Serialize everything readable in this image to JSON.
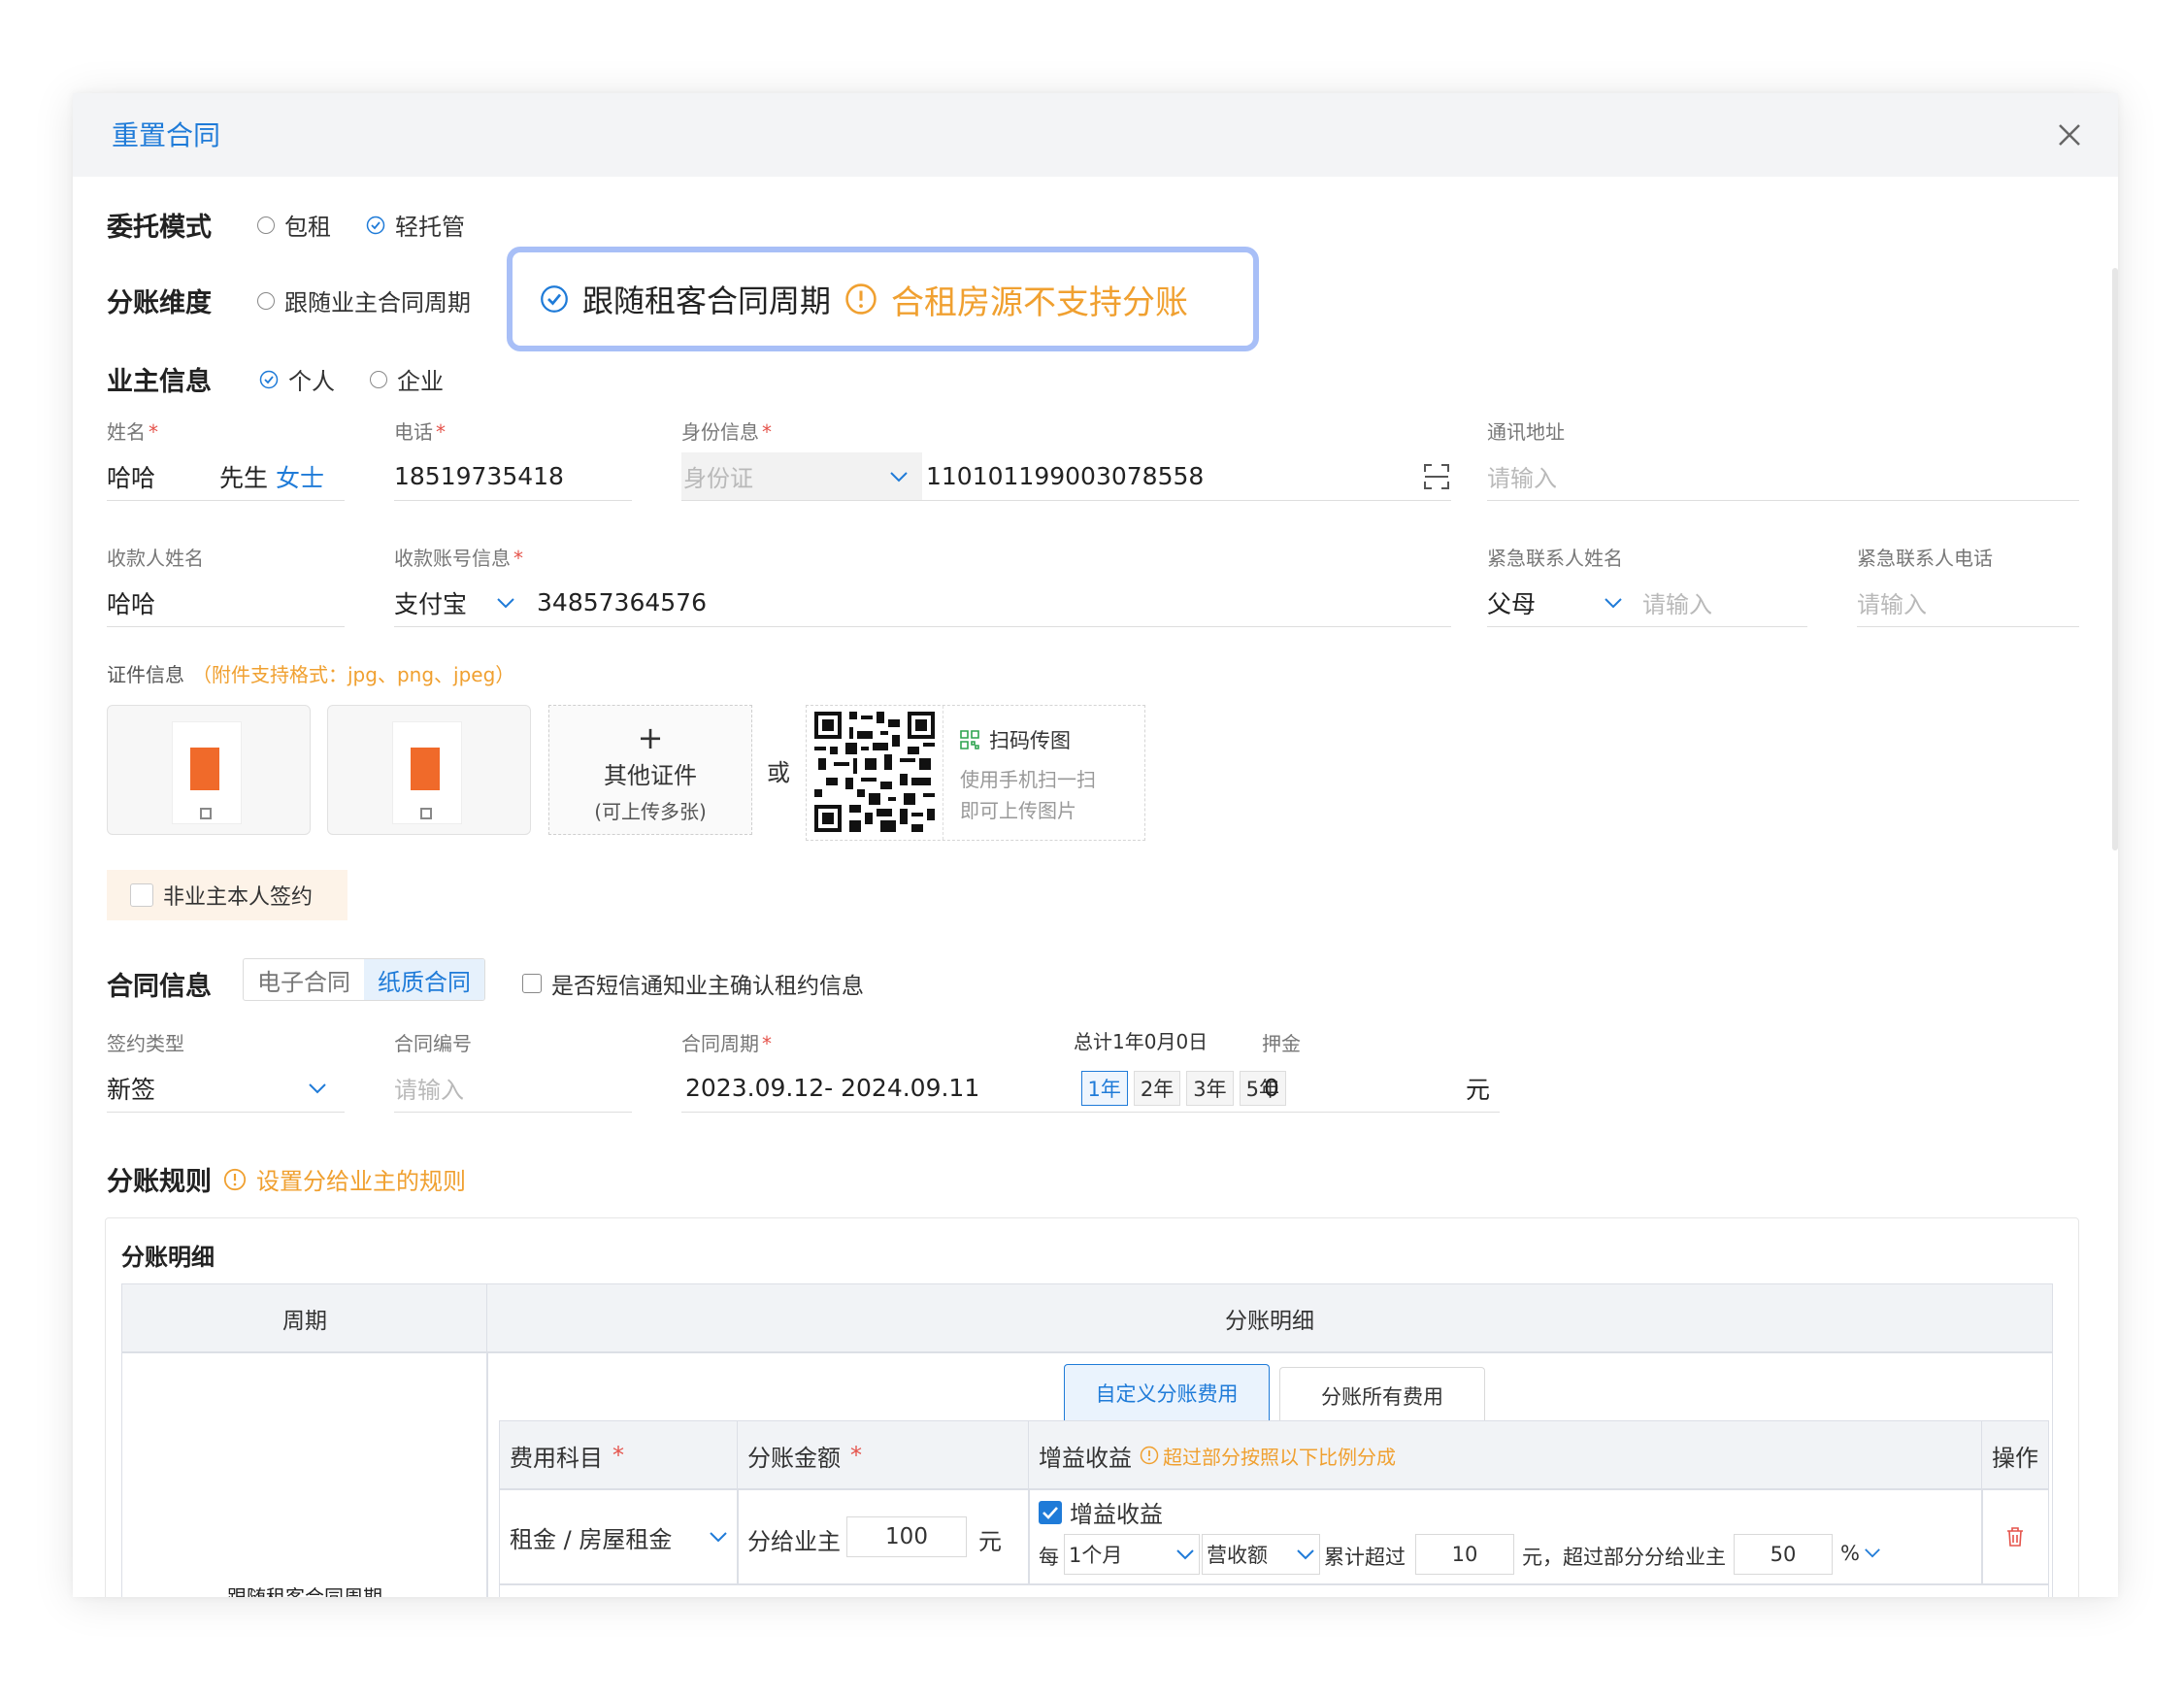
{
  "dialog": {
    "title": "重置合同"
  },
  "entrust": {
    "label": "委托模式",
    "options": [
      "包租",
      "轻托管"
    ],
    "selected": "轻托管"
  },
  "split_dim": {
    "label": "分账维度",
    "options": [
      "跟随业主合同周期",
      "跟随租客合同周期"
    ],
    "tooltip_warning": "合租房源不支持分账"
  },
  "owner": {
    "label": "业主信息",
    "options": [
      "个人",
      "企业"
    ],
    "selected": "个人"
  },
  "fields": {
    "name_label": "姓名",
    "name_value": "哈哈",
    "gender_male": "先生",
    "gender_female": "女士",
    "phone_label": "电话",
    "phone_value": "18519735418",
    "id_label": "身份信息",
    "id_type": "身份证",
    "id_value": "110101199003078558",
    "addr_label": "通讯地址",
    "addr_placeholder": "请输入",
    "payee_label": "收款人姓名",
    "payee_value": "哈哈",
    "account_label": "收款账号信息",
    "account_type": "支付宝",
    "account_value": "34857364576",
    "emerg_name_label": "紧急联系人姓名",
    "emerg_relation": "父母",
    "emerg_name_placeholder": "请输入",
    "emerg_phone_label": "紧急联系人电话",
    "emerg_phone_placeholder": "请输入"
  },
  "docs": {
    "label": "证件信息",
    "hint": "（附件支持格式：jpg、png、jpeg）",
    "other_title": "其他证件",
    "other_sub": "(可上传多张)",
    "or": "或",
    "scan_title": "扫码传图",
    "scan_line1": "使用手机扫一扫",
    "scan_line2": "即可上传图片",
    "non_owner": "非业主本人签约"
  },
  "contract": {
    "label": "合同信息",
    "tabs": [
      "电子合同",
      "纸质合同"
    ],
    "active_tab": "纸质合同",
    "sms_label": "是否短信通知业主确认租约信息",
    "sign_type_label": "签约类型",
    "sign_type": "新签",
    "number_label": "合同编号",
    "number_placeholder": "请输入",
    "period_label": "合同周期",
    "total": "总计1年0月0日",
    "period": "2023.09.12- 2024.09.11",
    "years": [
      "1年",
      "2年",
      "3年",
      "5年"
    ],
    "active_year": "1年",
    "deposit_label": "押金",
    "deposit": "0",
    "unit": "元"
  },
  "rules": {
    "label": "分账规则",
    "hint": "设置分给业主的规则",
    "detail_title": "分账明细",
    "col_period": "周期",
    "col_detail": "分账明细",
    "row_period": "跟随租客合同周期",
    "tabs": [
      "自定义分账费用",
      "分账所有费用"
    ],
    "th_item": "费用科目",
    "th_amount": "分账金额",
    "th_gain": "增益收益",
    "th_gain_hint": "超过部分按照以下比例分成",
    "th_op": "操作",
    "item": "租金 / 房屋租金",
    "amount_prefix": "分给业主",
    "amount": "100",
    "amount_unit": "元",
    "gain_check": "增益收益",
    "every": "每",
    "period_sel": "1个月",
    "basis_sel": "营收额",
    "exceed": "累计超过",
    "exceed_val": "10",
    "exceed_suffix": "元，超过部分分给业主",
    "percent": "50",
    "percent_sign": "%"
  }
}
